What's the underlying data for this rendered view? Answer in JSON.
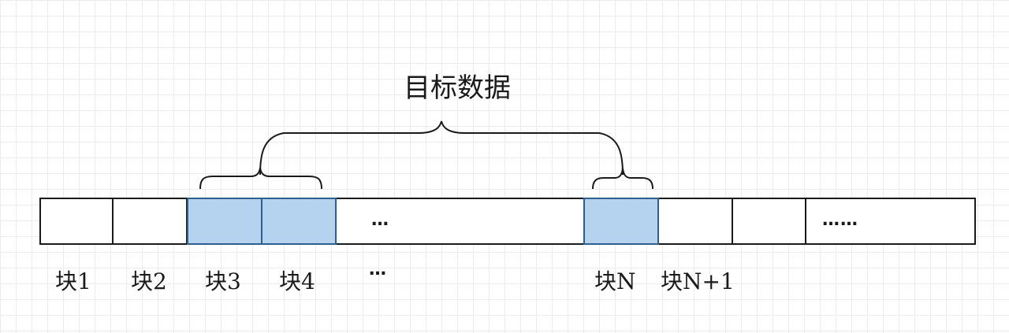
{
  "diagram": {
    "title": "目标数据",
    "bar_ellipsis": "…",
    "bar_ellipsis_long": "……",
    "labels": {
      "b1": "块1",
      "b2": "块2",
      "b3": "块3",
      "b4": "块4",
      "mid": "…",
      "bn": "块N",
      "bn1": "块N+1"
    },
    "highlighted_blocks": [
      "块3",
      "块4",
      "块N"
    ],
    "colors": {
      "highlight_fill": "#b5d2ee",
      "highlight_border": "#2f5f8f",
      "line": "#1a1a1a",
      "grid": "#ececec"
    }
  }
}
